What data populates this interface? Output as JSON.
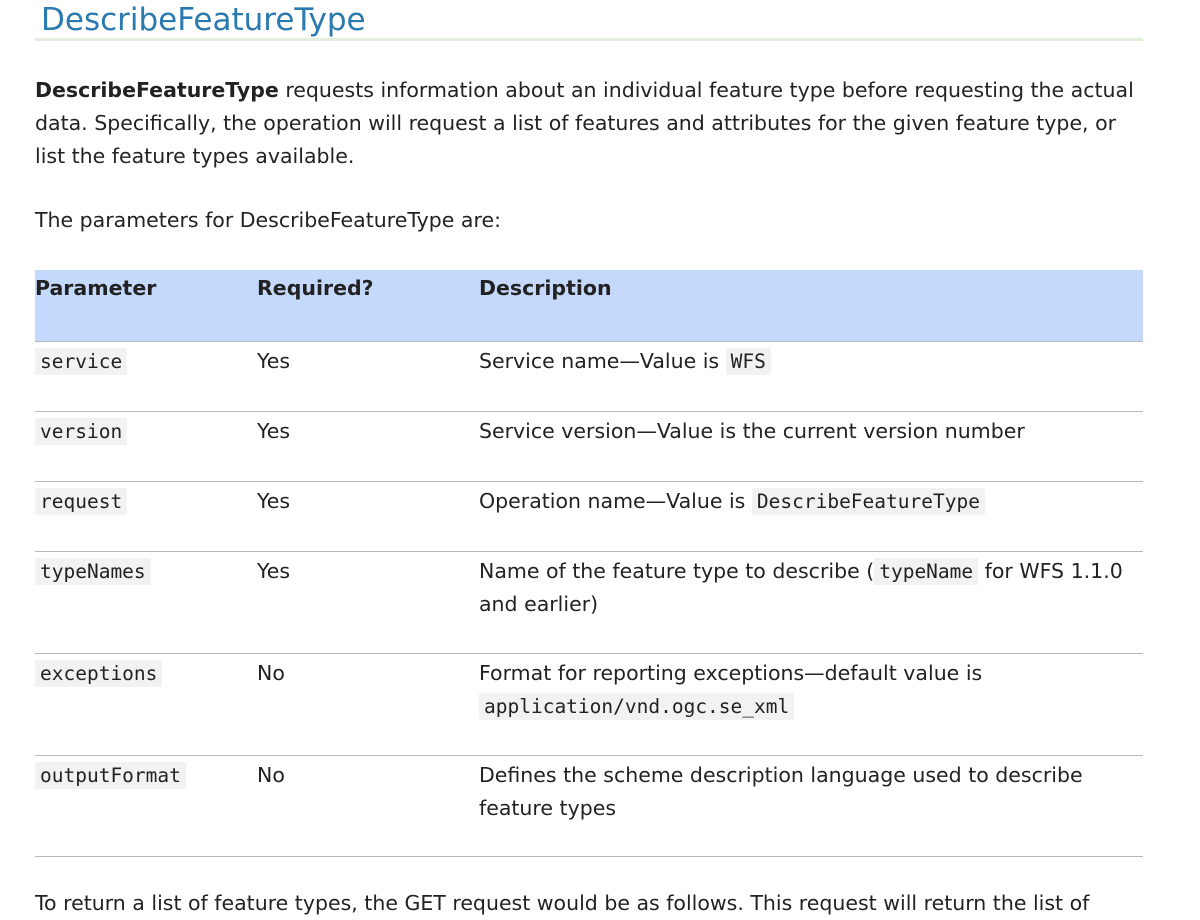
{
  "title": "DescribeFeatureType",
  "intro": {
    "term": "DescribeFeatureType",
    "text": " requests information about an individual feature type before requesting the actual data. Specifically, the operation will request a list of features and attributes for the given feature type, or list the feature types available."
  },
  "params_intro": "The parameters for DescribeFeatureType are:",
  "table": {
    "headers": {
      "parameter": "Parameter",
      "required": "Required?",
      "description": "Description"
    },
    "rows": [
      {
        "param": "service",
        "required": "Yes",
        "desc": "Service name—Value is ",
        "code": "WFS",
        "desc_after": ""
      },
      {
        "param": "version",
        "required": "Yes",
        "desc": "Service version—Value is the current version number",
        "code": "",
        "desc_after": ""
      },
      {
        "param": "request",
        "required": "Yes",
        "desc": "Operation name—Value is ",
        "code": "DescribeFeatureType",
        "desc_after": ""
      },
      {
        "param": "typeNames",
        "required": "Yes",
        "desc": "Name of the feature type to describe (",
        "code": "typeName",
        "desc_after": " for WFS 1.1.0 and earlier)"
      },
      {
        "param": "exceptions",
        "required": "No",
        "desc": "Format for reporting exceptions—default value is ",
        "code": "application/vnd.ogc.se_xml",
        "desc_after": ""
      },
      {
        "param": "outputFormat",
        "required": "No",
        "desc": "Defines the scheme description language used to describe feature types",
        "code": "",
        "desc_after": ""
      }
    ]
  },
  "outro": "To return a list of feature types, the GET request would be as follows. This request will return the list of"
}
